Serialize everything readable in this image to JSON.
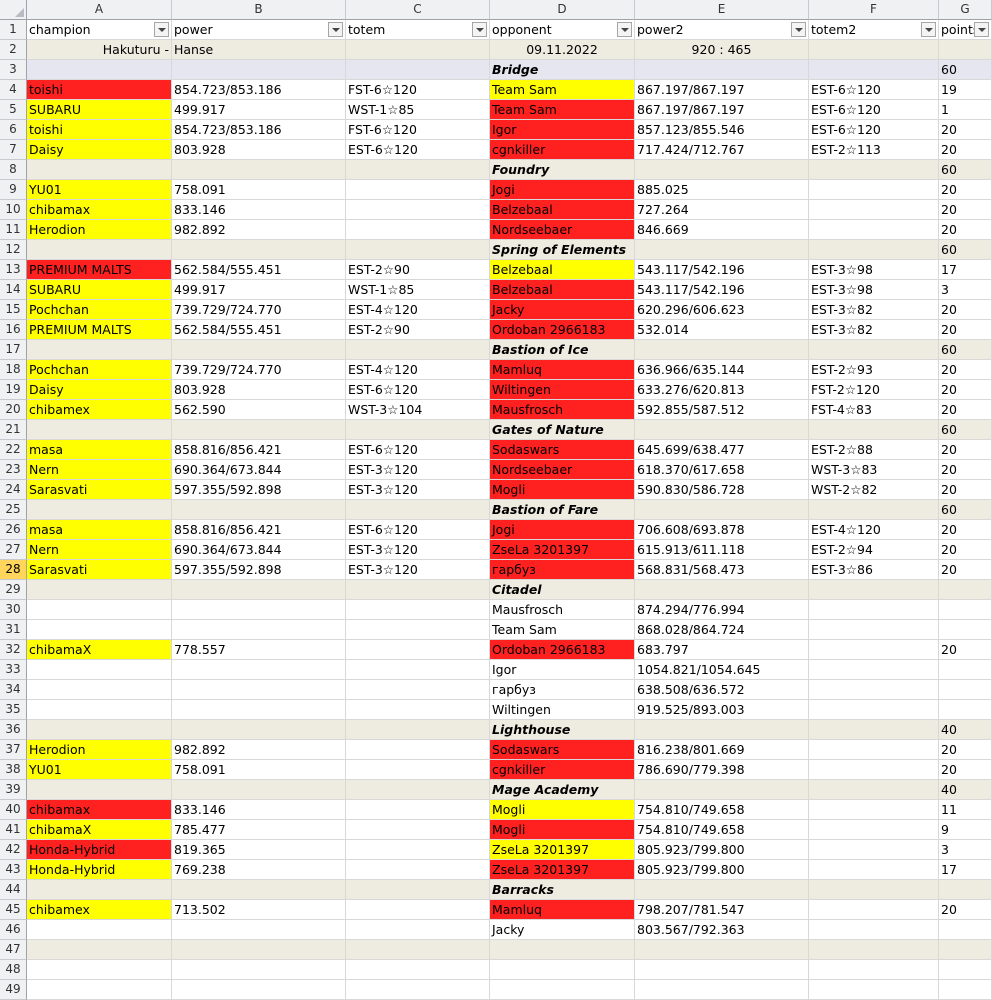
{
  "columns": [
    "A",
    "B",
    "C",
    "D",
    "E",
    "F",
    "G"
  ],
  "header_row": [
    "champion",
    "power",
    "totem",
    "opponent",
    "power2",
    "totem2",
    "points"
  ],
  "colors": {
    "red": "#ff2020",
    "yellow": "#ffff00",
    "section": "#eeece1",
    "selected_row_header": "#ffd55c"
  },
  "rows": [
    {
      "n": 2,
      "type": "info",
      "A": "Hakuturu -",
      "B": "Hanse",
      "C": "",
      "D": "09.11.2022",
      "E": "920 : 465",
      "F": "",
      "G": ""
    },
    {
      "n": 3,
      "type": "section",
      "section_bg": "lavender",
      "D": "Bridge",
      "G": "60"
    },
    {
      "n": 4,
      "A": "toishi",
      "A_bg": "red",
      "B": "854.723/853.186",
      "C": "FST-6☆120",
      "D": "Team Sam",
      "D_bg": "yellow",
      "E": "867.197/867.197",
      "F": "EST-6☆120",
      "G": "19"
    },
    {
      "n": 5,
      "A": "SUBARU",
      "A_bg": "yellow",
      "B": "499.917",
      "C": "WST-1☆85",
      "D": "Team Sam",
      "D_bg": "red",
      "E": "867.197/867.197",
      "F": "EST-6☆120",
      "G": "1"
    },
    {
      "n": 6,
      "A": "toishi",
      "A_bg": "yellow",
      "B": "854.723/853.186",
      "C": "FST-6☆120",
      "D": "Igor",
      "D_bg": "red",
      "E": "857.123/855.546",
      "F": "EST-6☆120",
      "G": "20"
    },
    {
      "n": 7,
      "A": "Daisy",
      "A_bg": "yellow",
      "B": "803.928",
      "C": "EST-6☆120",
      "D": "cgnkiller",
      "D_bg": "red",
      "E": "717.424/712.767",
      "F": "EST-2☆113",
      "G": "20"
    },
    {
      "n": 8,
      "type": "section",
      "D": "Foundry",
      "G": "60"
    },
    {
      "n": 9,
      "A": "YU01",
      "A_bg": "yellow",
      "B": "758.091",
      "C": "",
      "D": "Jogi",
      "D_bg": "red",
      "E": "885.025",
      "F": "",
      "G": "20"
    },
    {
      "n": 10,
      "A": "chibamax",
      "A_bg": "yellow",
      "B": "833.146",
      "C": "",
      "D": "Belzebaal",
      "D_bg": "red",
      "E": "727.264",
      "F": "",
      "G": "20"
    },
    {
      "n": 11,
      "A": "Herodion",
      "A_bg": "yellow",
      "B": "982.892",
      "C": "",
      "D": "Nordseebaer",
      "D_bg": "red",
      "E": "846.669",
      "F": "",
      "G": "20"
    },
    {
      "n": 12,
      "type": "section",
      "D": "Spring of Elements",
      "G": "60"
    },
    {
      "n": 13,
      "A": "PREMIUM MALTS",
      "A_bg": "red",
      "B": "562.584/555.451",
      "C": "EST-2☆90",
      "D": "Belzebaal",
      "D_bg": "yellow",
      "E": "543.117/542.196",
      "F": "EST-3☆98",
      "G": "17"
    },
    {
      "n": 14,
      "A": "SUBARU",
      "A_bg": "yellow",
      "B": "499.917",
      "C": "WST-1☆85",
      "D": "Belzebaal",
      "D_bg": "red",
      "E": "543.117/542.196",
      "F": "EST-3☆98",
      "G": "3"
    },
    {
      "n": 15,
      "A": "Pochchan",
      "A_bg": "yellow",
      "B": "739.729/724.770",
      "C": "EST-4☆120",
      "D": "Jacky",
      "D_bg": "red",
      "E": "620.296/606.623",
      "F": "EST-3☆82",
      "G": "20"
    },
    {
      "n": 16,
      "A": "PREMIUM MALTS",
      "A_bg": "yellow",
      "B": "562.584/555.451",
      "C": "EST-2☆90",
      "D": "Ordoban 2966183",
      "D_bg": "red",
      "E": "532.014",
      "F": "EST-3☆82",
      "G": "20"
    },
    {
      "n": 17,
      "type": "section",
      "D": "Bastion of Ice",
      "G": "60"
    },
    {
      "n": 18,
      "A": "Pochchan",
      "A_bg": "yellow",
      "B": "739.729/724.770",
      "C": "EST-4☆120",
      "D": "Mamluq",
      "D_bg": "red",
      "E": "636.966/635.144",
      "F": "EST-2☆93",
      "G": "20"
    },
    {
      "n": 19,
      "A": "Daisy",
      "A_bg": "yellow",
      "B": "803.928",
      "C": "EST-6☆120",
      "D": "Wiltingen",
      "D_bg": "red",
      "E": "633.276/620.813",
      "F": "FST-2☆120",
      "G": "20"
    },
    {
      "n": 20,
      "A": "chibamex",
      "A_bg": "yellow",
      "B": "562.590",
      "C": "WST-3☆104",
      "D": "Mausfrosch",
      "D_bg": "red",
      "E": "592.855/587.512",
      "F": "FST-4☆83",
      "G": "20"
    },
    {
      "n": 21,
      "type": "section",
      "D": "Gates of Nature",
      "G": "60"
    },
    {
      "n": 22,
      "A": "masa",
      "A_bg": "yellow",
      "B": "858.816/856.421",
      "C": "EST-6☆120",
      "D": "Sodaswars",
      "D_bg": "red",
      "E": "645.699/638.477",
      "F": "EST-2☆88",
      "G": "20"
    },
    {
      "n": 23,
      "A": "Nern",
      "A_bg": "yellow",
      "B": "690.364/673.844",
      "C": "EST-3☆120",
      "D": "Nordseebaer",
      "D_bg": "red",
      "E": "618.370/617.658",
      "F": "WST-3☆83",
      "G": "20"
    },
    {
      "n": 24,
      "A": "Sarasvati",
      "A_bg": "yellow",
      "B": "597.355/592.898",
      "C": "EST-3☆120",
      "D": "Mogli",
      "D_bg": "red",
      "E": "590.830/586.728",
      "F": "WST-2☆82",
      "G": "20"
    },
    {
      "n": 25,
      "type": "section",
      "D": "Bastion of Fare",
      "G": "60"
    },
    {
      "n": 26,
      "A": "masa",
      "A_bg": "yellow",
      "B": "858.816/856.421",
      "C": "EST-6☆120",
      "D": "Jogi",
      "D_bg": "red",
      "E": "706.608/693.878",
      "F": "EST-4☆120",
      "G": "20"
    },
    {
      "n": 27,
      "A": "Nern",
      "A_bg": "yellow",
      "B": "690.364/673.844",
      "C": "EST-3☆120",
      "D": "ZseLa 3201397",
      "D_bg": "red",
      "E": "615.913/611.118",
      "F": "EST-2☆94",
      "G": "20"
    },
    {
      "n": 28,
      "A": "Sarasvati",
      "A_bg": "yellow",
      "B": "597.355/592.898",
      "C": "EST-3☆120",
      "D": "гарбуз",
      "D_bg": "red",
      "E": "568.831/568.473",
      "F": "EST-3☆86",
      "G": "20",
      "selected": true
    },
    {
      "n": 29,
      "type": "section",
      "D": "Citadel",
      "G": ""
    },
    {
      "n": 30,
      "A": "",
      "B": "",
      "C": "",
      "D": "Mausfrosch",
      "E": "874.294/776.994",
      "F": "",
      "G": ""
    },
    {
      "n": 31,
      "A": "",
      "B": "",
      "C": "",
      "D": "Team Sam",
      "E": "868.028/864.724",
      "F": "",
      "G": ""
    },
    {
      "n": 32,
      "A": "chibamaX",
      "A_bg": "yellow",
      "B": "778.557",
      "C": "",
      "D": "Ordoban 2966183",
      "D_bg": "red",
      "E": "683.797",
      "F": "",
      "G": "20"
    },
    {
      "n": 33,
      "A": "",
      "B": "",
      "C": "",
      "D": "Igor",
      "E": "1054.821/1054.645",
      "F": "",
      "G": ""
    },
    {
      "n": 34,
      "A": "",
      "B": "",
      "C": "",
      "D": "гарбуз",
      "E": "638.508/636.572",
      "F": "",
      "G": ""
    },
    {
      "n": 35,
      "A": "",
      "B": "",
      "C": "",
      "D": "Wiltingen",
      "E": "919.525/893.003",
      "F": "",
      "G": ""
    },
    {
      "n": 36,
      "type": "section",
      "D": "Lighthouse",
      "G": "40"
    },
    {
      "n": 37,
      "A": "Herodion",
      "A_bg": "yellow",
      "B": "982.892",
      "C": "",
      "D": "Sodaswars",
      "D_bg": "red",
      "E": "816.238/801.669",
      "F": "",
      "G": "20"
    },
    {
      "n": 38,
      "A": "YU01",
      "A_bg": "yellow",
      "B": "758.091",
      "C": "",
      "D": "cgnkiller",
      "D_bg": "red",
      "E": "786.690/779.398",
      "F": "",
      "G": "20"
    },
    {
      "n": 39,
      "type": "section",
      "D": "Mage Academy",
      "G": "40"
    },
    {
      "n": 40,
      "A": "chibamax",
      "A_bg": "red",
      "B": "833.146",
      "C": "",
      "D": "Mogli",
      "D_bg": "yellow",
      "E": "754.810/749.658",
      "F": "",
      "G": "11"
    },
    {
      "n": 41,
      "A": "chibamaX",
      "A_bg": "yellow",
      "B": "785.477",
      "C": "",
      "D": "Mogli",
      "D_bg": "red",
      "E": "754.810/749.658",
      "F": "",
      "G": "9"
    },
    {
      "n": 42,
      "A": "Honda-Hybrid",
      "A_bg": "red",
      "B": "819.365",
      "C": "",
      "D": "ZseLa 3201397",
      "D_bg": "yellow",
      "E": "805.923/799.800",
      "F": "",
      "G": "3"
    },
    {
      "n": 43,
      "A": "Honda-Hybrid",
      "A_bg": "yellow",
      "B": "769.238",
      "C": "",
      "D": "ZseLa 3201397",
      "D_bg": "red",
      "E": "805.923/799.800",
      "F": "",
      "G": "17"
    },
    {
      "n": 44,
      "type": "section",
      "D": "Barracks",
      "G": ""
    },
    {
      "n": 45,
      "A": "chibamex",
      "A_bg": "yellow",
      "B": "713.502",
      "C": "",
      "D": "Mamluq",
      "D_bg": "red",
      "E": "798.207/781.547",
      "F": "",
      "G": "20"
    },
    {
      "n": 46,
      "A": "",
      "B": "",
      "C": "",
      "D": "Jacky",
      "E": "803.567/792.363",
      "F": "",
      "G": ""
    },
    {
      "n": 47,
      "type": "section",
      "D": "",
      "G": ""
    },
    {
      "n": 48,
      "A": "",
      "B": "",
      "C": "",
      "D": "",
      "E": "",
      "F": "",
      "G": ""
    },
    {
      "n": 49,
      "A": "",
      "B": "",
      "C": "",
      "D": "",
      "E": "",
      "F": "",
      "G": ""
    }
  ]
}
